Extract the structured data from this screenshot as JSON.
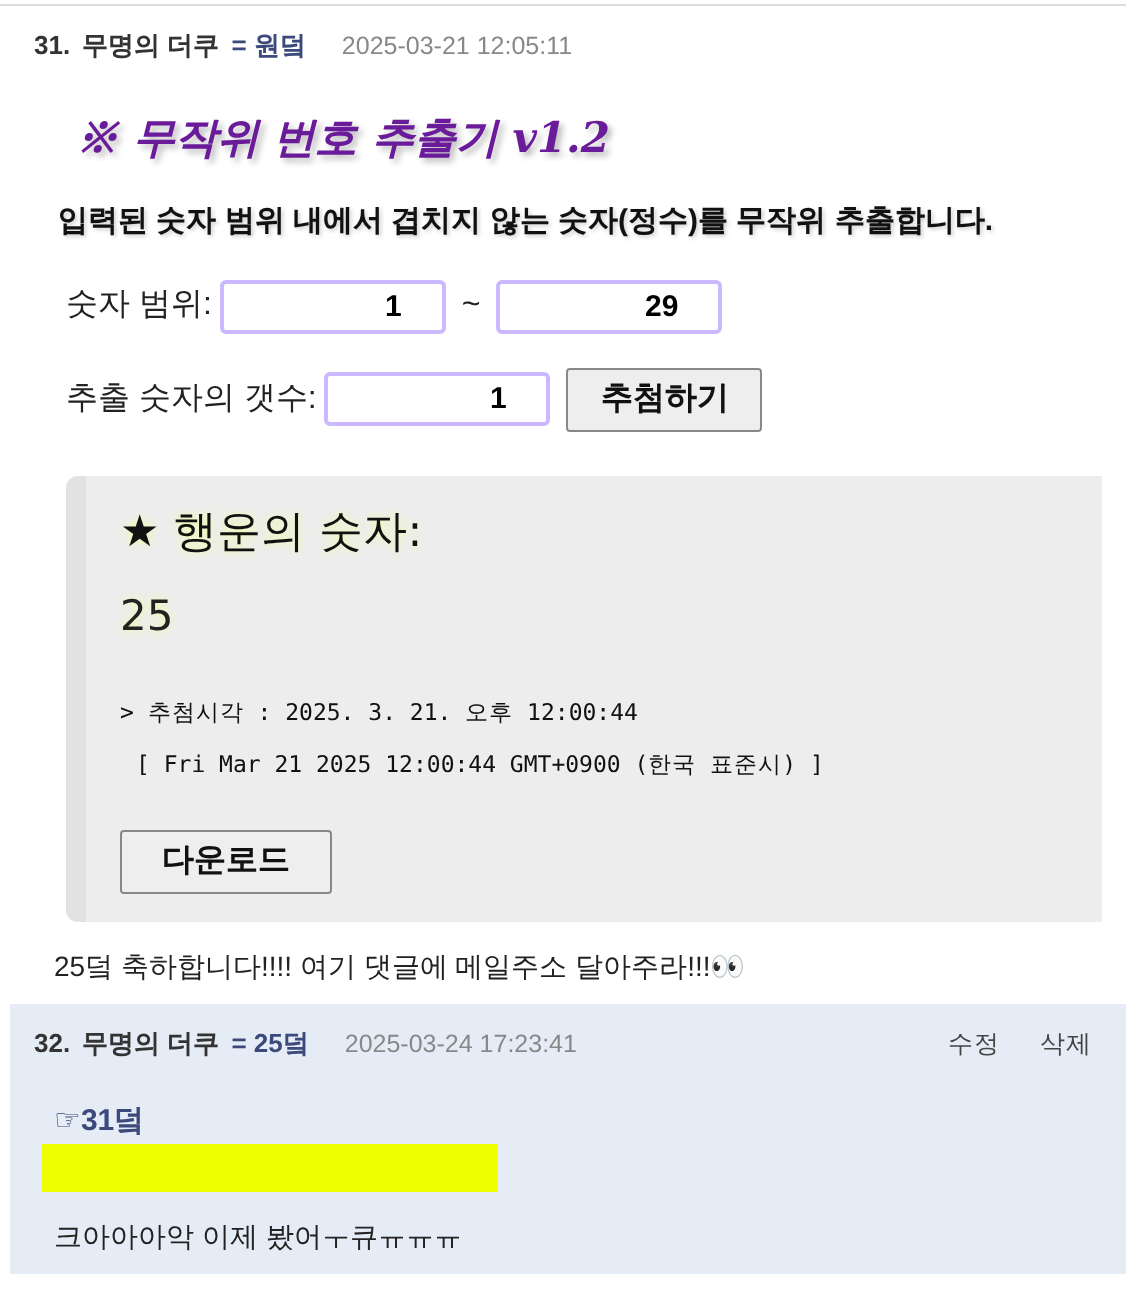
{
  "comments": [
    {
      "number": "31.",
      "author": "무명의 더쿠",
      "tag": "= 원덬",
      "time": "2025-03-21 12:05:11",
      "own": false,
      "widget": {
        "title": "※ 무작위 번호 추출기 v1.2",
        "description": "입력된 숫자 범위 내에서 겹치지 않는 숫자(정수)를 무작위 추출합니다.",
        "range_label": "숫자 범위:",
        "range_from": "1",
        "range_sep": "~",
        "range_to": "29",
        "count_label": "추출 숫자의 갯수:",
        "count": "1",
        "draw_button": "추첨하기",
        "result": {
          "heading": "★ 행운의 숫자:",
          "numbers": "25",
          "time_line": "> 추첨시각 : 2025. 3. 21. 오후 12:00:44",
          "date_line": "[ Fri Mar 21 2025 12:00:44 GMT+0900 (한국 표준시) ]",
          "download_button": "다운로드"
        }
      },
      "text": "25덬 축하합니다!!!! 여기 댓글에 메일주소 달아주라!!!👀"
    },
    {
      "number": "32.",
      "author": "무명의 더쿠",
      "tag": "= 25덬",
      "time": "2025-03-24 17:23:41",
      "own": true,
      "actions": [
        "수정",
        "삭제"
      ],
      "reply_to": "☞31덬",
      "redacted": true,
      "text": "크아아아악 이제 봤어ㅜ큐ㅠㅠㅠ"
    }
  ]
}
